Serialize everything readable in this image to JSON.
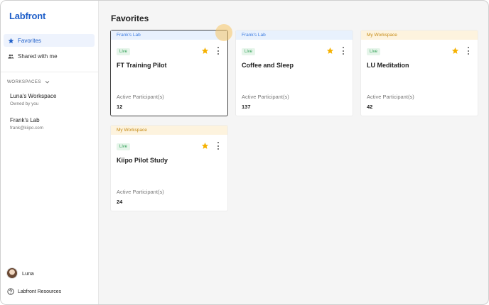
{
  "app": {
    "logo": "Labfront"
  },
  "sidebar": {
    "nav": [
      {
        "label": "Favorites",
        "icon": "star-icon",
        "active": true
      },
      {
        "label": "Shared with me",
        "icon": "people-icon",
        "active": false
      }
    ],
    "workspaces_header": "WORKSPACES",
    "workspaces": [
      {
        "name": "Luna's Workspace",
        "sub": "Owned by you"
      },
      {
        "name": "Frank's Lab",
        "sub": "frank@kiipo.com"
      }
    ],
    "user": {
      "name": "Luna"
    },
    "resources_label": "Labfront Resources"
  },
  "main": {
    "title": "Favorites",
    "cards": [
      {
        "workspace": "Frank's Lab",
        "status": "Live",
        "title": "FT Training Pilot",
        "participants_label": "Active Participant(s)",
        "participants": "12"
      },
      {
        "workspace": "Frank's Lab",
        "status": "Live",
        "title": "Coffee and Sleep",
        "participants_label": "Active Participant(s)",
        "participants": "137"
      },
      {
        "workspace": "My Workspace",
        "status": "Live",
        "title": "LU Meditation",
        "participants_label": "Active Participant(s)",
        "participants": "42"
      },
      {
        "workspace": "My Workspace",
        "status": "Live",
        "title": "Kiipo Pilot Study",
        "participants_label": "Active Participant(s)",
        "participants": "24"
      }
    ]
  },
  "colors": {
    "brand": "#1f5fc9",
    "star": "#f5b100",
    "live": "#2f9f55",
    "franks_header": "#e8f1fd",
    "mine_header": "#fdf3de"
  }
}
